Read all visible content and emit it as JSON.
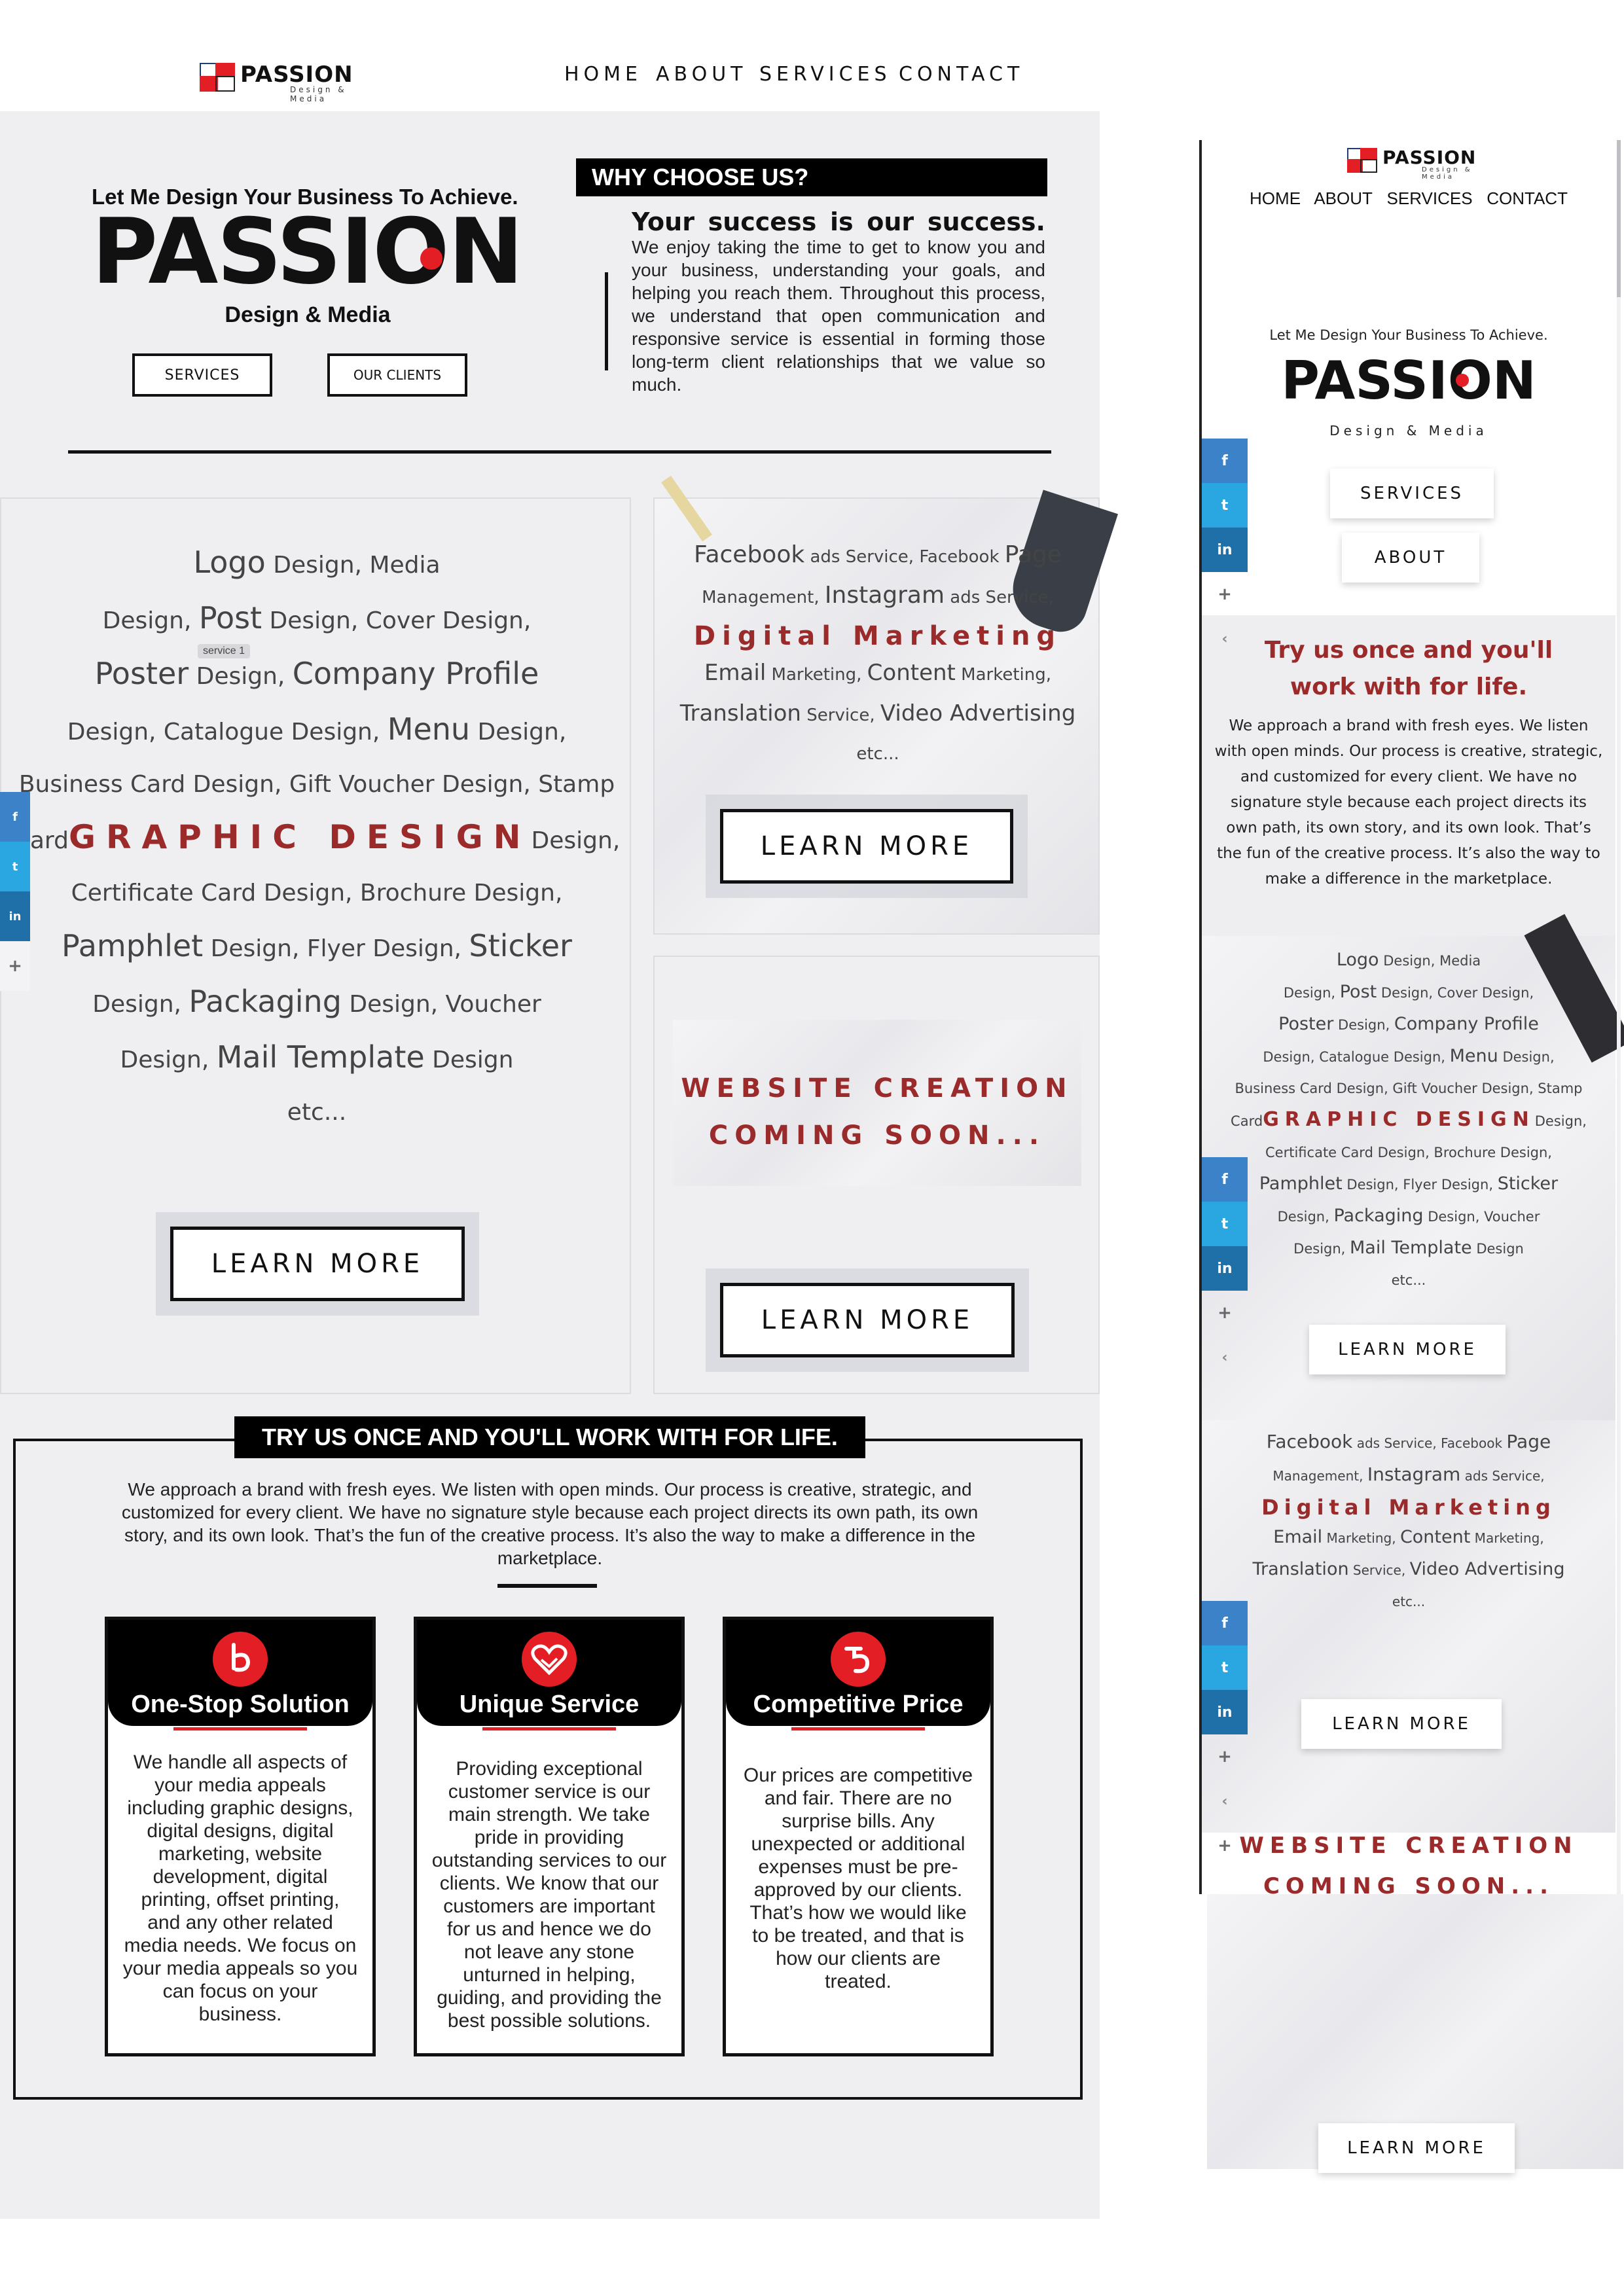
{
  "desktop": {
    "brand": {
      "name": "PASSION",
      "sub": "Design & Media"
    },
    "nav": [
      "HOME",
      "ABOUT",
      "SERVICES",
      "CONTACT"
    ],
    "hero": {
      "tagline": "Let Me Design Your Business To Achieve.",
      "brand_big": "PASSION",
      "brand_sub": "Design & Media",
      "btn_services": "SERVICES",
      "btn_clients": "OUR CLIENTS"
    },
    "why": {
      "heading": "WHY CHOOSE US?",
      "lead": "Your success is our success.",
      "body": "We enjoy taking the time to get to know you and your business, understanding your goals, and helping you reach them. Throughout this process, we understand that open communication and responsive service is essential in forming those long-term client relationships that we value so much."
    },
    "graphic": {
      "l1a": "Logo",
      "l1b": " Design, Media",
      "l2a": "Design, ",
      "l2b": "Post",
      "l2c": " Design, Cover Design,",
      "l3a": "Poster",
      "l3b": " Design, ",
      "l3c": "Company Profile",
      "l4a": "Design, Catalogue Design, ",
      "l4b": "Menu",
      "l4c": " Design,",
      "l5": "Business Card Design, Gift Voucher Design, Stamp",
      "l6a": "Card",
      "l6b": "GRAPHIC DESIGN",
      "l6c": "Design,",
      "l7": "Certificate Card Design, Brochure Design,",
      "l8a": "Pamphlet",
      "l8b": " Design, Flyer Design, ",
      "l8c": "Sticker",
      "l9a": "Design, ",
      "l9b": "Packaging",
      "l9c": " Design, Voucher",
      "l10a": "Design, ",
      "l10b": "Mail Template",
      "l10c": " Design",
      "l11": "etc...",
      "tooltip": "service 1",
      "learn": "LEARN MORE"
    },
    "digital": {
      "l1a": "Facebook",
      "l1b": " ads Service, Facebook ",
      "l1c": "Page",
      "l2a": "Management, ",
      "l2b": "Instagram",
      "l2c": " ads Service,",
      "l3": "Digital Marketing",
      "l4a": "Email",
      "l4b": " Marketing, ",
      "l4c": "Content",
      "l4d": " Marketing,",
      "l5a": "Translation",
      "l5b": " Service, ",
      "l5c": "Video Advertising",
      "l6": "etc...",
      "learn": "LEARN MORE"
    },
    "website": {
      "l1": "WEBSITE CREATION",
      "l2": "COMING SOON...",
      "learn": "LEARN MORE"
    },
    "try": {
      "heading": "TRY US ONCE AND YOU'LL WORK WITH FOR LIFE.",
      "body": "We approach a brand with fresh eyes. We listen with open minds. Our process is creative, strategic, and customized for every client. We have no signature style because each project directs its own path, its own story, and its own look. That’s the fun of the creative process. It’s also the way to make a difference in the marketplace."
    },
    "cards": [
      {
        "icon": "one-stop-icon",
        "title": "One-Stop Solution",
        "body": "We handle all aspects of your media appeals including graphic designs, digital designs, digital marketing, website development, digital printing, offset printing, and any other related media needs. We focus on your media appeals so you can focus on your business."
      },
      {
        "icon": "handshake-heart-icon",
        "title": "Unique Service",
        "body": "Providing exceptional customer service is our main strength. We take pride in providing outstanding services to our clients. We know that our customers are important for us and hence we do not leave any stone unturned in helping, guiding, and providing the best possible solutions."
      },
      {
        "icon": "price-tag-icon",
        "title": "Competitive Price",
        "body": "Our prices are competitive and fair. There are no surprise bills. Any unexpected or additional expenses must be pre-approved by our clients. That’s how we would like to be treated, and that is how our clients are treated."
      }
    ],
    "share": {
      "plus": "+"
    }
  },
  "mobile": {
    "brand": {
      "name": "PASSION",
      "sub": "Design & Media"
    },
    "nav": [
      "HOME",
      "ABOUT",
      "SERVICES",
      "CONTACT"
    ],
    "hero": {
      "tagline": "Let Me Design Your Business To Achieve.",
      "brand_big": "PASSION",
      "brand_sub": "Design & Media",
      "btn_services": "SERVICES",
      "btn_about": "ABOUT"
    },
    "try": {
      "heading": "Try us once and you'll work with for life.",
      "body": "We approach a brand with fresh eyes. We listen with open minds. Our process is creative, strategic, and customized for every client. We have no signature style because each project directs its own path, its own story, and its own look. That’s the fun of the creative process. It’s also the way to make a difference in the marketplace."
    },
    "learn": "LEARN MORE",
    "share": {
      "plus": "+",
      "less": "‹"
    }
  },
  "colors": {
    "accent_red": "#e31e24",
    "dark_red": "#9b2a2a",
    "black": "#000000",
    "panel_grey": "#efeff1"
  }
}
